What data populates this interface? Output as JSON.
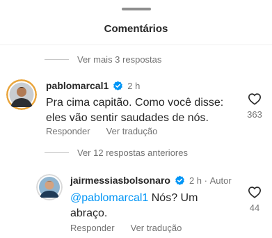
{
  "header": {
    "title": "Comentários"
  },
  "more_replies_top": {
    "label": "Ver mais 3 respostas"
  },
  "comments": [
    {
      "username": "pablomarcal1",
      "time": "2 h",
      "text": "Pra cima capitão. Como você disse: eles vão sentir saudades de nós.",
      "reply_label": "Responder",
      "translate_label": "Ver tradução",
      "likes": "363"
    },
    {
      "username": "jairmessiasbolsonaro",
      "time": "2 h",
      "author_tag": "Autor",
      "mention": "@pablomarcal1",
      "text": " Nós? Um abraço.",
      "reply_label": "Responder",
      "translate_label": "Ver tradução",
      "likes": "44"
    }
  ],
  "more_replies_prev": {
    "label": "Ver 12 respostas anteriores"
  },
  "colors": {
    "accent": "#0095f6",
    "verified": "#0095f6",
    "secondary_text": "#737373"
  },
  "icons": {
    "verified": "verified-badge-icon",
    "like": "heart-outline-icon"
  }
}
